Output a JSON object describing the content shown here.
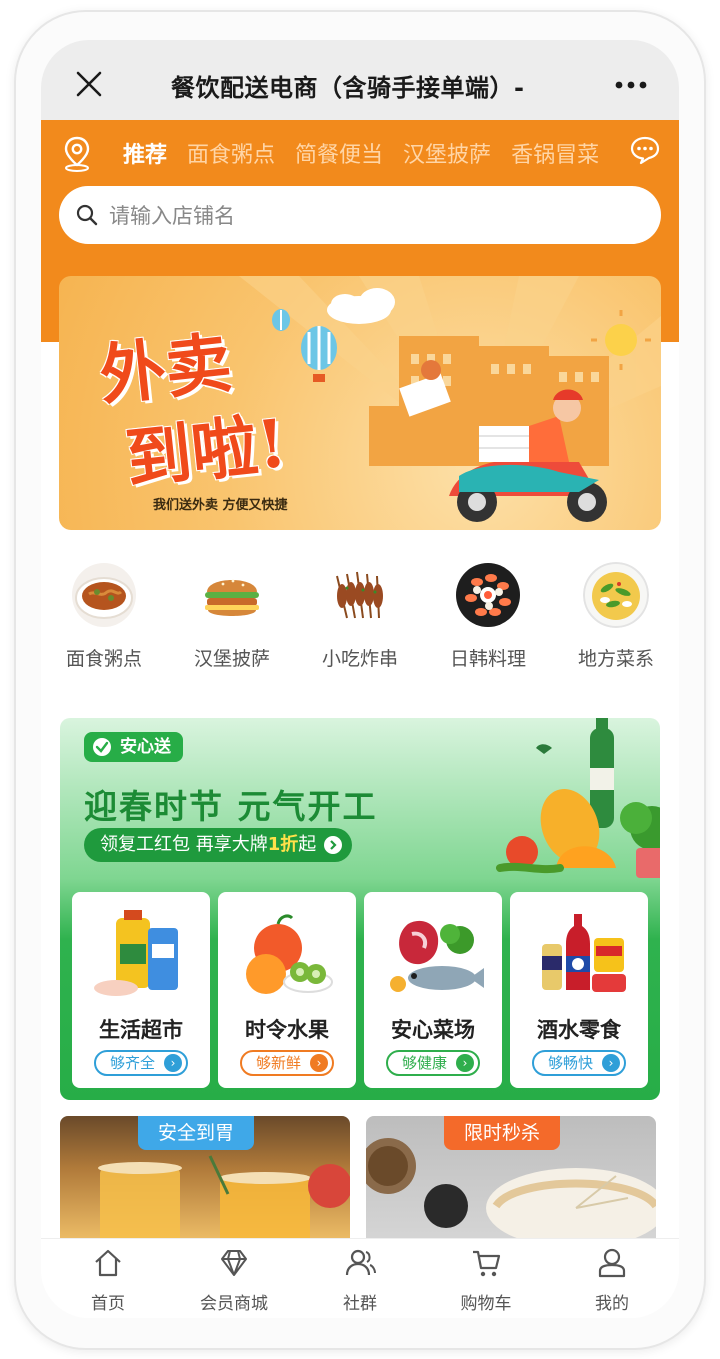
{
  "window": {
    "title": "餐饮配送电商（含骑手接单端）- "
  },
  "header": {
    "tabs": [
      {
        "label": "推荐",
        "active": true
      },
      {
        "label": "面食粥点",
        "active": false
      },
      {
        "label": "简餐便当",
        "active": false
      },
      {
        "label": "汉堡披萨",
        "active": false
      },
      {
        "label": "香锅冒菜",
        "active": false
      }
    ],
    "search_placeholder": "请输入店铺名",
    "colors": {
      "brand": "#f28a1c",
      "active_tab": "#ffffff",
      "inactive_tab": "#ffd5a6"
    }
  },
  "banner": {
    "line1": "外卖",
    "line2": "到啦!",
    "subtitle": "我们送外卖 方便又快捷"
  },
  "categories": [
    {
      "label": "面食粥点",
      "icon": "noodle-bowl"
    },
    {
      "label": "汉堡披萨",
      "icon": "burger"
    },
    {
      "label": "小吃炸串",
      "icon": "skewers"
    },
    {
      "label": "日韩料理",
      "icon": "sushi-platter"
    },
    {
      "label": "地方菜系",
      "icon": "local-dish"
    }
  ],
  "promo": {
    "badge": "安心送",
    "title": "迎春时节 元气开工",
    "subtitle_prefix": "领复工红包 再享大牌",
    "subtitle_highlight": "1折",
    "subtitle_suffix": "起",
    "cards": [
      {
        "name": "生活超市",
        "tag": "够齐全",
        "color": "#2f9fd8"
      },
      {
        "name": "时令水果",
        "tag": "够新鲜",
        "color": "#f07b22"
      },
      {
        "name": "安心菜场",
        "tag": "够健康",
        "color": "#2fae4c"
      },
      {
        "name": "酒水零食",
        "tag": "够畅快",
        "color": "#2f9fd8"
      }
    ],
    "colors": {
      "accent": "#27ad47",
      "highlight": "#ffe14a"
    }
  },
  "features": [
    {
      "tag": "安全到胃",
      "color": "#3fa8e8"
    },
    {
      "tag": "限时秒杀",
      "color": "#f46a2a"
    }
  ],
  "tabbar": [
    {
      "label": "首页",
      "icon": "home-icon"
    },
    {
      "label": "会员商城",
      "icon": "diamond-icon"
    },
    {
      "label": "社群",
      "icon": "community-icon"
    },
    {
      "label": "购物车",
      "icon": "cart-icon"
    },
    {
      "label": "我的",
      "icon": "profile-icon"
    }
  ]
}
